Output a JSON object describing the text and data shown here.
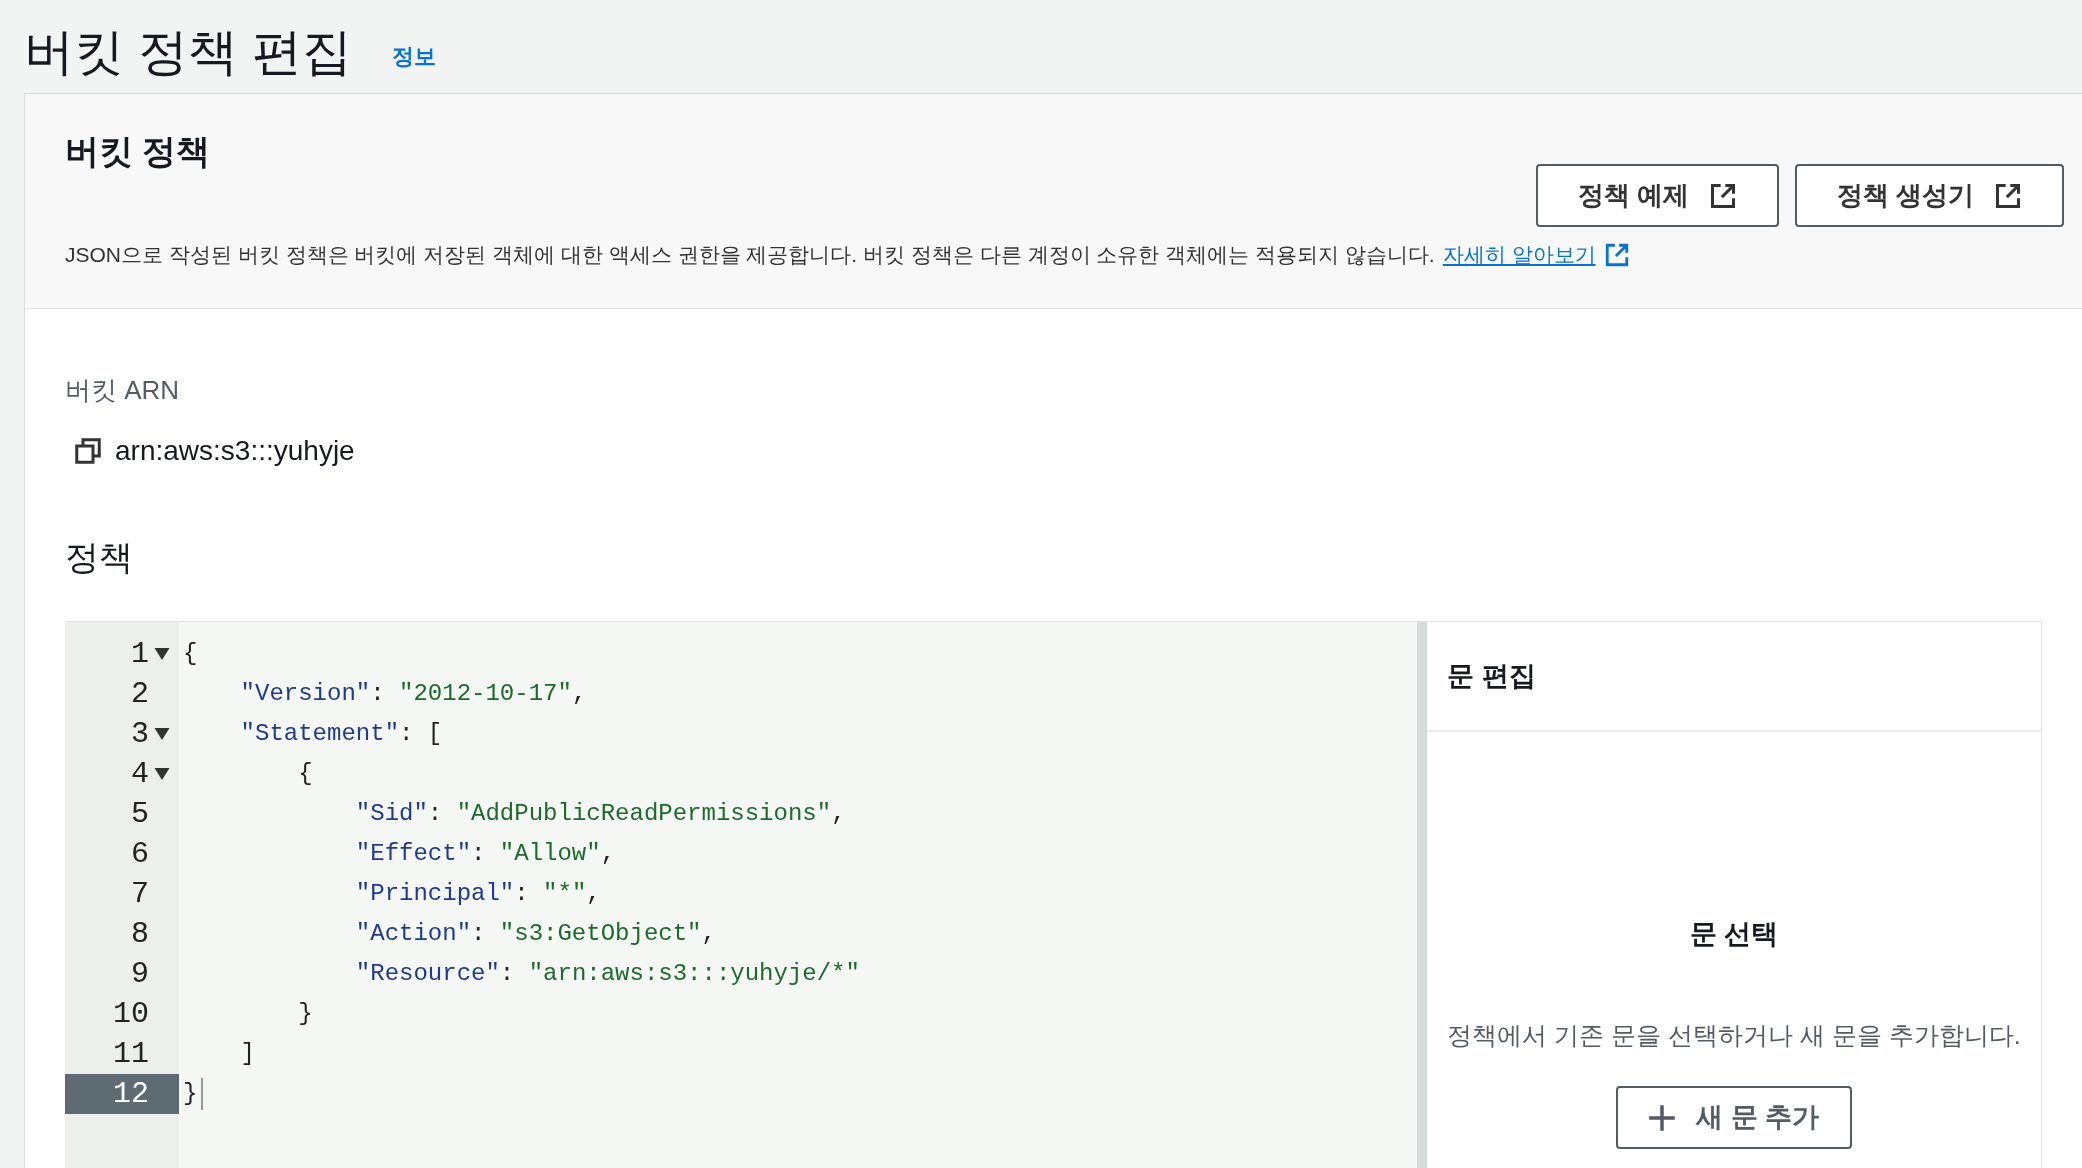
{
  "page": {
    "title": "버킷 정책 편집",
    "info_link": "정보"
  },
  "policy_card": {
    "title": "버킷 정책",
    "description": "JSON으로 작성된 버킷 정책은 버킷에 저장된 객체에 대한 액세스 권한을 제공합니다. 버킷 정책은 다른 계정이 소유한 객체에는 적용되지 않습니다.",
    "learn_more_link": "자세히 알아보기",
    "buttons": [
      "정책 예제",
      "정책 생성기"
    ]
  },
  "arn": {
    "label": "버킷 ARN",
    "value": "arn:aws:s3:::yuhyje"
  },
  "policy": {
    "label": "정책",
    "code_lines": [
      {
        "number": "1",
        "foldable": true,
        "selected": false,
        "tokens": [
          {
            "kind": "punct",
            "text": "{"
          }
        ]
      },
      {
        "number": "2",
        "foldable": false,
        "selected": false,
        "tokens": [
          {
            "kind": "key",
            "text": "    \"Version\""
          },
          {
            "kind": "punct",
            "text": ": "
          },
          {
            "kind": "string",
            "text": "\"2012-10-17\""
          },
          {
            "kind": "punct",
            "text": ","
          }
        ]
      },
      {
        "number": "3",
        "foldable": true,
        "selected": false,
        "tokens": [
          {
            "kind": "key",
            "text": "    \"Statement\""
          },
          {
            "kind": "punct",
            "text": ": ["
          }
        ]
      },
      {
        "number": "4",
        "foldable": true,
        "selected": false,
        "tokens": [
          {
            "kind": "punct",
            "text": "        {"
          }
        ]
      },
      {
        "number": "5",
        "foldable": false,
        "selected": false,
        "tokens": [
          {
            "kind": "key",
            "text": "            \"Sid\""
          },
          {
            "kind": "punct",
            "text": ": "
          },
          {
            "kind": "string",
            "text": "\"AddPublicReadPermissions\""
          },
          {
            "kind": "punct",
            "text": ","
          }
        ]
      },
      {
        "number": "6",
        "foldable": false,
        "selected": false,
        "tokens": [
          {
            "kind": "key",
            "text": "            \"Effect\""
          },
          {
            "kind": "punct",
            "text": ": "
          },
          {
            "kind": "string",
            "text": "\"Allow\""
          },
          {
            "kind": "punct",
            "text": ","
          }
        ]
      },
      {
        "number": "7",
        "foldable": false,
        "selected": false,
        "tokens": [
          {
            "kind": "key",
            "text": "            \"Principal\""
          },
          {
            "kind": "punct",
            "text": ": "
          },
          {
            "kind": "string",
            "text": "\"*\""
          },
          {
            "kind": "punct",
            "text": ","
          }
        ]
      },
      {
        "number": "8",
        "foldable": false,
        "selected": false,
        "tokens": [
          {
            "kind": "key",
            "text": "            \"Action\""
          },
          {
            "kind": "punct",
            "text": ": "
          },
          {
            "kind": "string",
            "text": "\"s3:GetObject\""
          },
          {
            "kind": "punct",
            "text": ","
          }
        ]
      },
      {
        "number": "9",
        "foldable": false,
        "selected": false,
        "tokens": [
          {
            "kind": "key",
            "text": "            \"Resource\""
          },
          {
            "kind": "punct",
            "text": ": "
          },
          {
            "kind": "string",
            "text": "\"arn:aws:s3:::yuhyje/*\""
          }
        ]
      },
      {
        "number": "10",
        "foldable": false,
        "selected": false,
        "tokens": [
          {
            "kind": "punct",
            "text": "        }"
          }
        ]
      },
      {
        "number": "11",
        "foldable": false,
        "selected": false,
        "tokens": [
          {
            "kind": "punct",
            "text": "    ]"
          }
        ]
      },
      {
        "number": "12",
        "foldable": false,
        "selected": true,
        "tokens": [
          {
            "kind": "punct",
            "text": "}"
          }
        ]
      }
    ]
  },
  "statement_panel": {
    "title": "문 편집",
    "empty_title": "문 선택",
    "empty_text": "정책에서 기존 문을 선택하거나 새 문을 추가합니다.",
    "add_button": "새 문 추가"
  }
}
